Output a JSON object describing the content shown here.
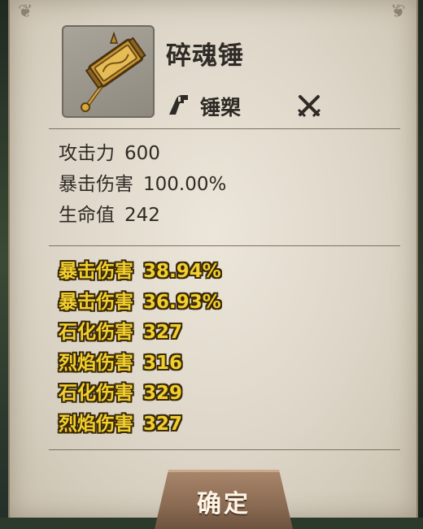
{
  "item": {
    "name": "碎魂锤",
    "type_label": "锤槊",
    "type_icon": "hammer-class-icon",
    "combat_icon": "crossed-swords-icon"
  },
  "base_stats": [
    {
      "label": "攻击力",
      "value": "600"
    },
    {
      "label": "暴击伤害",
      "value": "100.00%"
    },
    {
      "label": "生命值",
      "value": "242"
    }
  ],
  "affixes": [
    {
      "label": "暴击伤害",
      "value": "38.94%"
    },
    {
      "label": "暴击伤害",
      "value": "36.93%"
    },
    {
      "label": "石化伤害",
      "value": "327"
    },
    {
      "label": "烈焰伤害",
      "value": "316"
    },
    {
      "label": "石化伤害",
      "value": "329"
    },
    {
      "label": "烈焰伤害",
      "value": "327"
    }
  ],
  "buttons": {
    "confirm_label": "确定"
  },
  "colors": {
    "affix_text": "#f2cf2e",
    "parchment": "#ddd6c8",
    "button": "#8a6a52"
  }
}
